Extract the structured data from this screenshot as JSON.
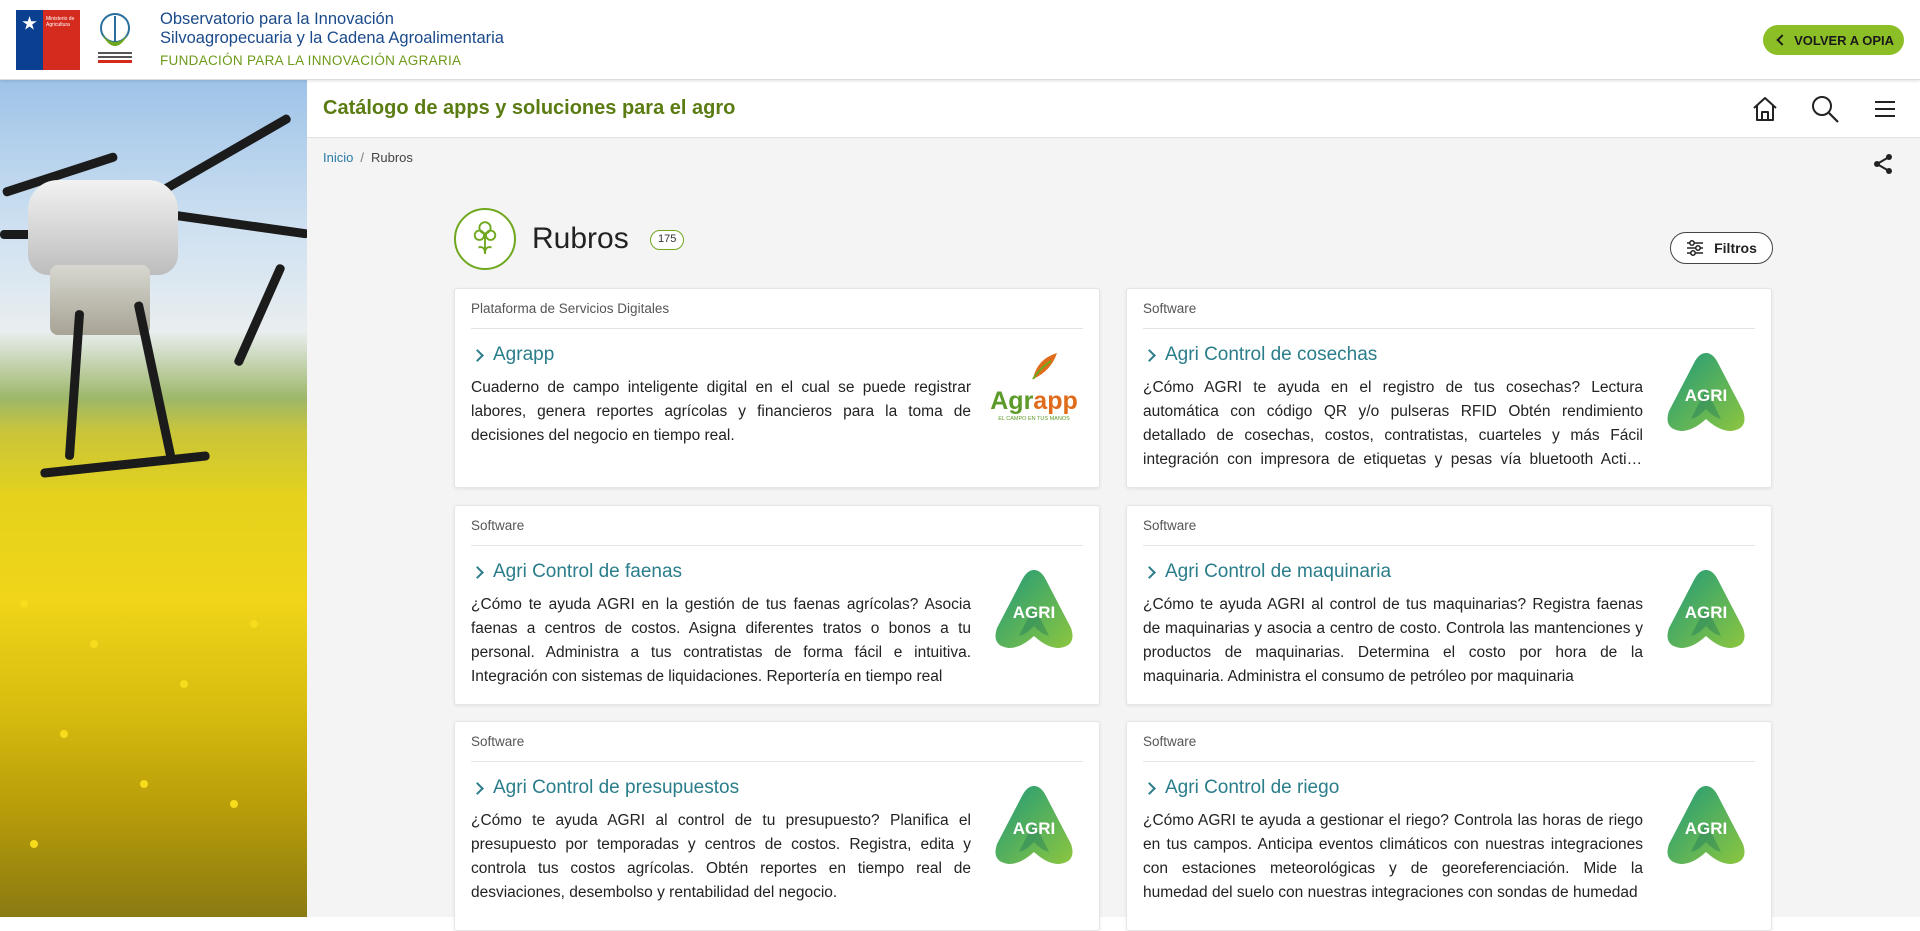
{
  "header": {
    "org_title_line1": "Observatorio para la Innovación",
    "org_title_line2": "Silvoagropecuaria y la Cadena Agroalimentaria",
    "org_subtitle": "FUNDACIÓN PARA LA INNOVACIÓN AGRARIA",
    "ministry_logo_text": "Ministerio de Agricultura",
    "back_button_label": "VOLVER A OPIA"
  },
  "subheader": {
    "catalog_title": "Catálogo de apps y soluciones para el agro"
  },
  "breadcrumb": {
    "items": [
      "Inicio",
      "Rubros"
    ]
  },
  "section": {
    "title": "Rubros",
    "count": "175",
    "filter_label": "Filtros"
  },
  "cards": [
    {
      "category": "Plataforma de Servicios Digitales",
      "title": "Agrapp",
      "description": "Cuaderno de campo inteligente digital en el cual se puede registrar labores, genera reportes agrícolas y financieros para la toma de decisiones del negocio en tiempo real.",
      "logo": "agrapp-logo",
      "logo_text": "Agrapp",
      "logo_tagline": "EL CAMPO EN TUS MANOS"
    },
    {
      "category": "Software",
      "title": "Agri Control de cosechas",
      "description": "¿Cómo AGRI te ayuda en el registro de tus cosechas? Lectura automática con código QR y/o pulseras RFID Obtén rendimiento detallado de cosechas, costos, contratistas, cuarteles y más Fácil integración con impresora de etiquetas y pesas vía bluetooth Activa alertas y notificaciones",
      "logo": "agri-logo",
      "logo_text": "AGRI"
    },
    {
      "category": "Software",
      "title": "Agri Control de faenas",
      "description": "¿Cómo te ayuda AGRI en la gestión de tus faenas agrícolas? Asocia faenas a centros de costos. Asigna diferentes tratos o bonos a tu personal. Administra a tus contratistas de forma fácil e intuitiva. Integración con sistemas de liquidaciones. Reportería en tiempo real",
      "logo": "agri-logo",
      "logo_text": "AGRI"
    },
    {
      "category": "Software",
      "title": "Agri Control de maquinaria",
      "description": "¿Cómo te ayuda AGRI al control de tus maquinarias? Registra faenas de maquinarias y asocia a centro de costo. Controla las mantenciones y productos de maquinarias. Determina el costo por hora de la maquinaria. Administra el consumo de petróleo por maquinaria",
      "logo": "agri-logo",
      "logo_text": "AGRI"
    },
    {
      "category": "Software",
      "title": "Agri Control de presupuestos",
      "description": "¿Cómo te ayuda AGRI al control de tu presupuesto? Planifica el presupuesto por temporadas y centros de costos. Registra, edita y controla tus costos agrícolas. Obtén reportes en tiempo real de desviaciones, desembolso y rentabilidad del negocio.",
      "logo": "agri-logo",
      "logo_text": "AGRI"
    },
    {
      "category": "Software",
      "title": "Agri Control de riego",
      "description": "¿Cómo AGRI te ayuda a gestionar el riego? Controla las horas de riego en tus campos. Anticipa eventos climáticos con nuestras integraciones con estaciones meteorológicas y de georeferenciación. Mide la humedad del suelo con nuestras integraciones con sondas de humedad",
      "logo": "agri-logo",
      "logo_text": "AGRI"
    }
  ],
  "colors": {
    "brand_green": "#6fa81e",
    "title_green": "#5b7c12",
    "link_teal": "#2a7d8a",
    "org_blue": "#1b4a8a",
    "button_green": "#8cbf26"
  },
  "icons": [
    "home-icon",
    "search-icon",
    "menu-icon",
    "share-icon",
    "filter-icon",
    "plant-icon",
    "chevron-left-icon",
    "chevron-right-icon"
  ]
}
